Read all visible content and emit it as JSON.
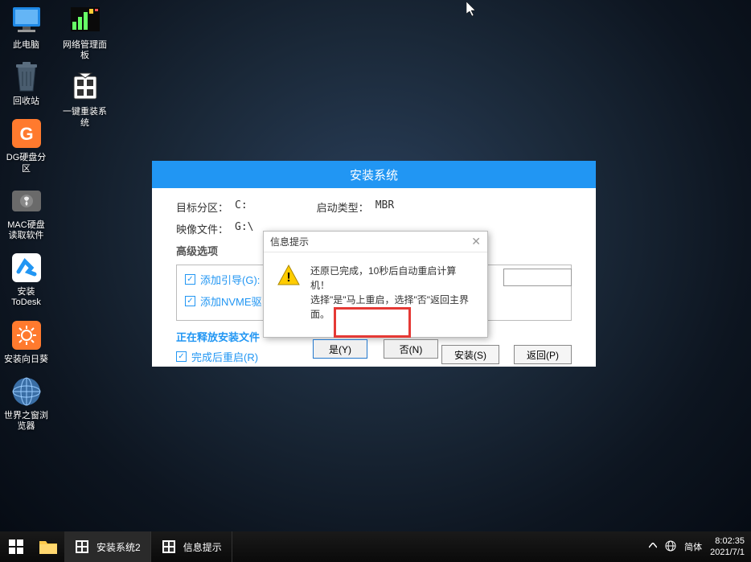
{
  "desktop": {
    "col1": [
      {
        "label": "此电脑",
        "icon": "monitor"
      },
      {
        "label": "回收站",
        "icon": "trash"
      },
      {
        "label": "DG硬盘分区",
        "icon": "dg"
      },
      {
        "label": "MAC硬盘读取软件",
        "icon": "mac"
      },
      {
        "label": "安装ToDesk",
        "icon": "todesk"
      },
      {
        "label": "安装向日葵",
        "icon": "sunflower"
      },
      {
        "label": "世界之窗浏览器",
        "icon": "globe"
      }
    ],
    "col2": [
      {
        "label": "网络管理面板",
        "icon": "chart"
      },
      {
        "label": "一键重装系统",
        "icon": "reinstall"
      }
    ]
  },
  "installer": {
    "title": "安装系统",
    "target_partition_label": "目标分区：",
    "target_partition_value": "C:",
    "boot_type_label": "启动类型：",
    "boot_type_value": "MBR",
    "image_file_label": "映像文件：",
    "image_file_value": "G:\\",
    "advanced_label": "高级选项",
    "add_boot_label": "添加引导(G):",
    "add_nvme_label": "添加NVME驱",
    "progress_text": "正在释放安装文件",
    "restart_label": "完成后重启(R)",
    "install_btn": "安装(S)",
    "return_btn": "返回(P)"
  },
  "dialog": {
    "title": "信息提示",
    "line1": "还原已完成，10秒后自动重启计算机！",
    "line2": "选择\"是\"马上重启，选择\"否\"返回主界面。",
    "yes_btn": "是(Y)",
    "no_btn": "否(N)"
  },
  "taskbar": {
    "item1": "安装系统2",
    "item2": "信息提示"
  },
  "systray": {
    "ime": "简体",
    "time": "8:02:35",
    "date": "2021/7/1"
  }
}
